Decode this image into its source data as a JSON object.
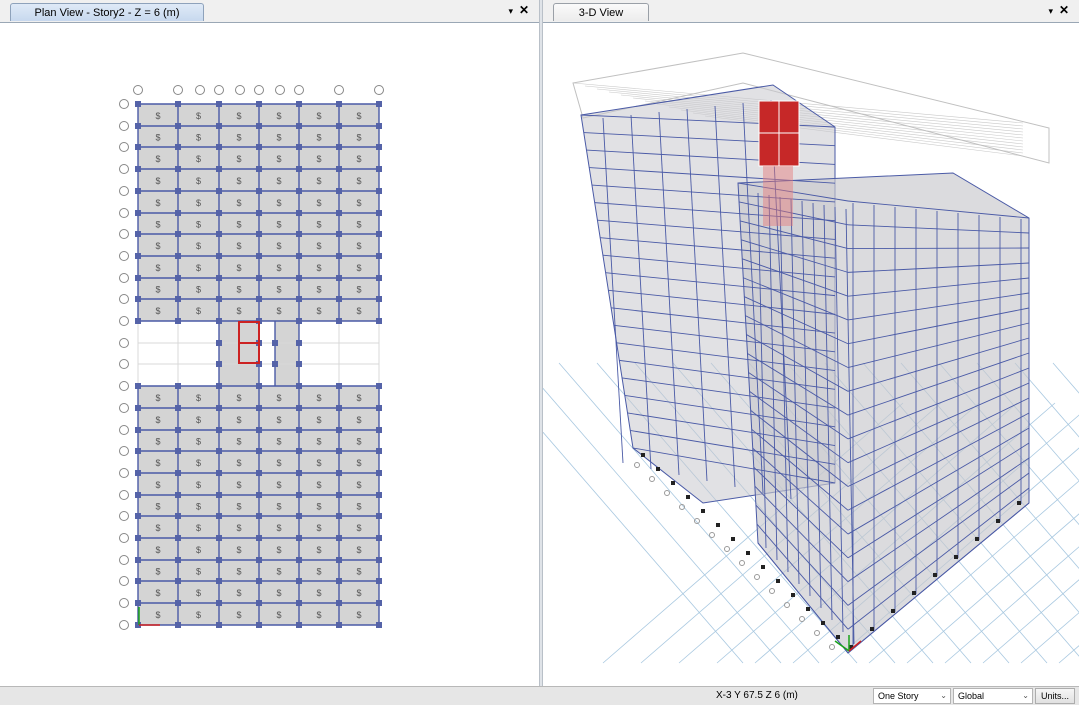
{
  "left_panel": {
    "tab_label": "Plan View - Story2 - Z = 6 (m)",
    "menu_glyph": "▾",
    "close_glyph": "✕",
    "slab_mark": "$"
  },
  "right_panel": {
    "tab_label": "3-D View",
    "menu_glyph": "▾",
    "close_glyph": "✕"
  },
  "status_bar": {
    "coordinates": "X-3  Y 67.5  Z 6 (m)",
    "story_select": "One Story",
    "coord_system_select": "Global",
    "units_button": "Units..."
  },
  "colors": {
    "beam": "#4a5aa6",
    "slab": "#d4d4d4",
    "column": "#5563a8",
    "highlight": "#cc2222",
    "grid_line": "#a8c8e0"
  },
  "icons": [
    "chevron-down-icon",
    "close-icon",
    "axis-triad-icon"
  ]
}
